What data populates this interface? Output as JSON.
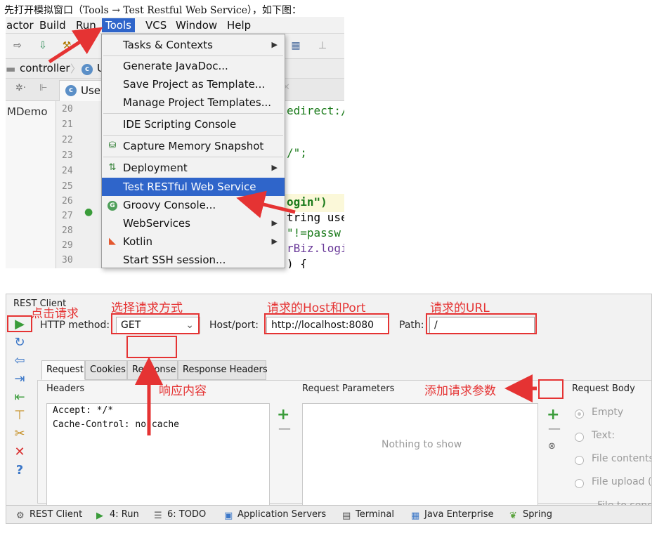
{
  "caption": "先打开模拟窗口（Tools → Test Restful Web Service），如下图：",
  "ide_top": {
    "menubar": [
      {
        "label": "actor"
      },
      {
        "label": "Build"
      },
      {
        "label": "Run"
      },
      {
        "label": "Tools",
        "active": true
      },
      {
        "label": "VCS"
      },
      {
        "label": "Window"
      },
      {
        "label": "Help"
      }
    ],
    "breadcrumb": {
      "folder": "controller",
      "class_letter": "c",
      "class_fragment": "U"
    },
    "editor_tab": {
      "letter": "c",
      "label": "Use"
    },
    "project_panel": "MDemo",
    "line_numbers": [
      "20",
      "21",
      "22",
      "23",
      "24",
      "25",
      "26",
      "27",
      "28",
      "29",
      "30"
    ],
    "code_fragments": [
      "edirect:/",
      "/\";",
      "ogin\")",
      "tring use",
      "\"!=passw",
      "rBiz.logi",
      ") {"
    ],
    "tools_menu": [
      {
        "label": "Tasks & Contexts",
        "submenu": true
      },
      {
        "label": "Generate JavaDoc..."
      },
      {
        "label": "Save Project as Template..."
      },
      {
        "label": "Manage Project Templates..."
      },
      {
        "label": "IDE Scripting Console"
      },
      {
        "label": "Capture Memory Snapshot"
      },
      {
        "label": "Deployment",
        "submenu": true
      },
      {
        "label": "Test RESTful Web Service",
        "selected": true
      },
      {
        "label": "Groovy Console..."
      },
      {
        "label": "WebServices",
        "submenu": true
      },
      {
        "label": "Kotlin",
        "submenu": true
      },
      {
        "label": "Start SSH session..."
      }
    ]
  },
  "rest_client": {
    "title": "REST Client",
    "http_method_label": "HTTP method:",
    "http_method_value": "GET",
    "host_label": "Host/port:",
    "host_value": "http://localhost:8080",
    "path_label": "Path:",
    "path_value": "/",
    "tabs": [
      "Request",
      "Cookies",
      "Response",
      "Response Headers"
    ],
    "headers_title": "Headers",
    "headers": [
      "Accept: */*",
      "Cache-Control: no-cache"
    ],
    "params_title": "Request Parameters",
    "params_empty": "Nothing to show",
    "body_title": "Request Body",
    "body_options": [
      "Empty",
      "Text:",
      "File contents",
      "File upload (",
      "File to send"
    ]
  },
  "status_bar": [
    "REST Client",
    "4: Run",
    "6: TODO",
    "Application Servers",
    "Terminal",
    "Java Enterprise",
    "Spring"
  ],
  "annotations": {
    "click_request": "点击请求",
    "choose_method": "选择请求方式",
    "host_port": "请求的Host和Port",
    "url": "请求的URL",
    "response": "响应内容",
    "add_param": "添加请求参数"
  },
  "colors": {
    "annotation_red": "#e53333",
    "menu_selected": "#2f65ca",
    "run_green": "#3a9c3a"
  }
}
